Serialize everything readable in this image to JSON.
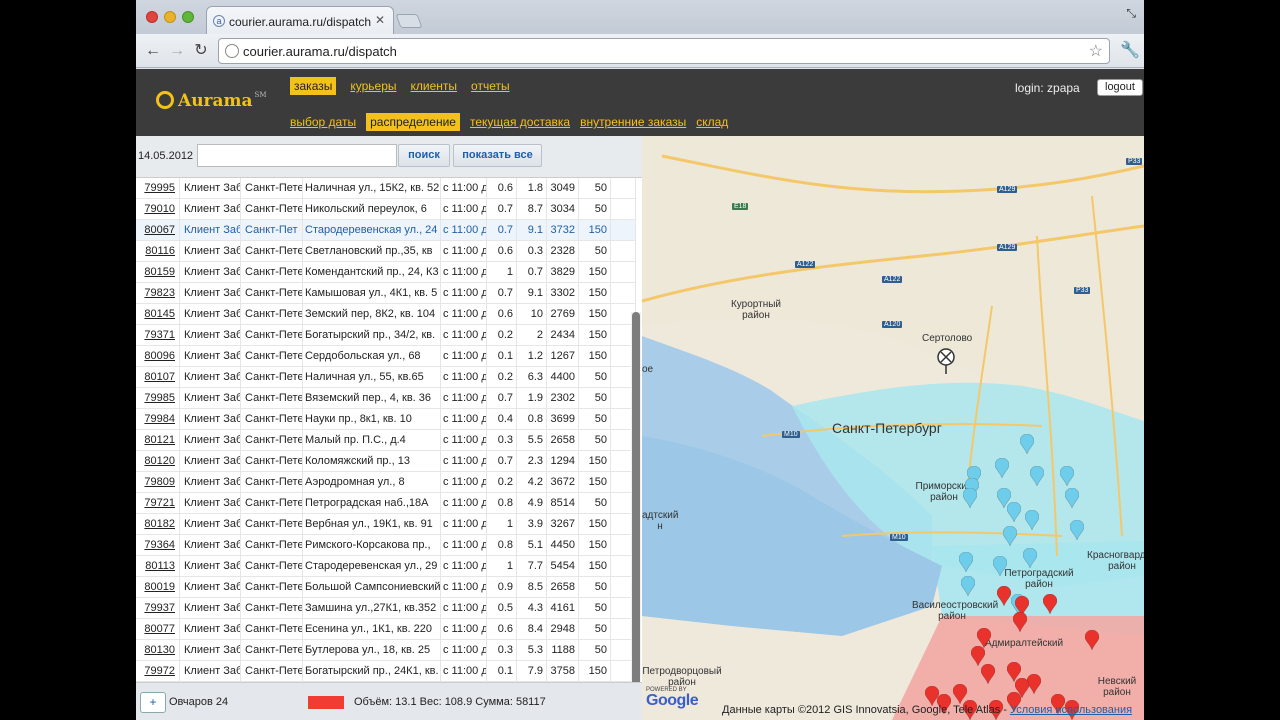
{
  "browser": {
    "tab_title": "courier.aurama.ru/dispatch",
    "url": "courier.aurama.ru/dispatch"
  },
  "app": {
    "logo": "Aurama",
    "logo_mark": "SM",
    "main_nav": [
      "заказы",
      "курьеры",
      "клиенты",
      "отчеты"
    ],
    "sub_nav": [
      "выбор даты",
      "распределение",
      "текущая доставка",
      "внутренние заказы",
      "склад"
    ],
    "main_active": 0,
    "sub_active": 1,
    "login_text": "login: zpapa",
    "logout_label": "logout"
  },
  "filter": {
    "date": "14.05.2012",
    "search_value": "",
    "search_label": "поиск",
    "show_all_label": "показать все"
  },
  "orders": [
    {
      "id": "79995",
      "client": "Клиент Заб",
      "city": "Санкт-Петер",
      "address": "Наличная ул., 15К2, кв. 52",
      "time": "с 11:00 д",
      "a": "0.6",
      "b": "1.8",
      "c": "3049",
      "d": "50"
    },
    {
      "id": "79010",
      "client": "Клиент Заб",
      "city": "Санкт-Петер",
      "address": "Никольский переулок, 6",
      "time": "с 11:00 д",
      "a": "0.7",
      "b": "8.7",
      "c": "3034",
      "d": "50"
    },
    {
      "id": "80067",
      "client": "Клиент Заб",
      "city": "Санкт-Пет",
      "address": "Стародеревенская ул., 24",
      "time": "с 11:00 д",
      "a": "0.7",
      "b": "9.1",
      "c": "3732",
      "d": "150",
      "selected": true
    },
    {
      "id": "80116",
      "client": "Клиент Заб",
      "city": "Санкт-Петер",
      "address": "Светлановский пр.,35, кв",
      "time": "с 11:00 д",
      "a": "0.6",
      "b": "0.3",
      "c": "2328",
      "d": "50"
    },
    {
      "id": "80159",
      "client": "Клиент Заб",
      "city": "Санкт-Петер",
      "address": "Комендантский пр., 24, К3",
      "time": "с 11:00 д",
      "a": "1",
      "b": "0.7",
      "c": "3829",
      "d": "150"
    },
    {
      "id": "79823",
      "client": "Клиент Заб",
      "city": "Санкт-Петер",
      "address": "Камышовая ул., 4К1, кв. 5",
      "time": "с 11:00 д",
      "a": "0.7",
      "b": "9.1",
      "c": "3302",
      "d": "150"
    },
    {
      "id": "80145",
      "client": "Клиент Заб",
      "city": "Санкт-Петер",
      "address": "Земский пер, 8К2, кв. 104",
      "time": "с 11:00 д",
      "a": "0.6",
      "b": "10",
      "c": "2769",
      "d": "150"
    },
    {
      "id": "79371",
      "client": "Клиент Заб",
      "city": "Санкт-Петер",
      "address": "Богатырский пр., 34/2, кв.",
      "time": "с 11:00 д",
      "a": "0.2",
      "b": "2",
      "c": "2434",
      "d": "150"
    },
    {
      "id": "80096",
      "client": "Клиент Заб",
      "city": "Санкт-Петер",
      "address": "Сердобольская ул., 68",
      "time": "с 11:00 д",
      "a": "0.1",
      "b": "1.2",
      "c": "1267",
      "d": "150"
    },
    {
      "id": "80107",
      "client": "Клиент Заб",
      "city": "Санкт-Петер",
      "address": "Наличная ул., 55, кв.65",
      "time": "с 11:00 д",
      "a": "0.2",
      "b": "6.3",
      "c": "4400",
      "d": "50"
    },
    {
      "id": "79985",
      "client": "Клиент Заб",
      "city": "Санкт-Петер",
      "address": "Вяземский пер., 4, кв. 36",
      "time": "с 11:00 д",
      "a": "0.7",
      "b": "1.9",
      "c": "2302",
      "d": "50"
    },
    {
      "id": "79984",
      "client": "Клиент Заб",
      "city": "Санкт-Петер",
      "address": "Науки пр., 8к1, кв. 10",
      "time": "с 11:00 д",
      "a": "0.4",
      "b": "0.8",
      "c": "3699",
      "d": "50"
    },
    {
      "id": "80121",
      "client": "Клиент Заб",
      "city": "Санкт-Петер",
      "address": "Малый пр. П.С., д.4",
      "time": "с 11:00 д",
      "a": "0.3",
      "b": "5.5",
      "c": "2658",
      "d": "50"
    },
    {
      "id": "80120",
      "client": "Клиент Заб",
      "city": "Санкт-Петер",
      "address": "Коломяжский пр., 13",
      "time": "с 11:00 д",
      "a": "0.7",
      "b": "2.3",
      "c": "1294",
      "d": "150"
    },
    {
      "id": "79809",
      "client": "Клиент Заб",
      "city": "Санкт-Петер",
      "address": "Аэродромная ул., 8",
      "time": "с 11:00 д",
      "a": "0.2",
      "b": "4.2",
      "c": "3672",
      "d": "150"
    },
    {
      "id": "79721",
      "client": "Клиент Заб",
      "city": "Санкт-Петер",
      "address": "Петроградская наб.,18А",
      "time": "с 11:00 д",
      "a": "0.8",
      "b": "4.9",
      "c": "8514",
      "d": "50"
    },
    {
      "id": "80182",
      "client": "Клиент Заб",
      "city": "Санкт-Петер",
      "address": "Вербная ул., 19К1, кв. 91",
      "time": "с 11:00 д",
      "a": "1",
      "b": "3.9",
      "c": "3267",
      "d": "150"
    },
    {
      "id": "79364",
      "client": "Клиент Заб",
      "city": "Санкт-Петер",
      "address": "Римского-Корсакова пр.,",
      "time": "с 11:00 д",
      "a": "0.8",
      "b": "5.1",
      "c": "4450",
      "d": "150"
    },
    {
      "id": "80113",
      "client": "Клиент Заб",
      "city": "Санкт-Петер",
      "address": "Стародеревенская ул., 29",
      "time": "с 11:00 д",
      "a": "1",
      "b": "7.7",
      "c": "5454",
      "d": "150"
    },
    {
      "id": "80019",
      "client": "Клиент Заб",
      "city": "Санкт-Петер",
      "address": "Большой Сампсониевский",
      "time": "с 11:00 д",
      "a": "0.9",
      "b": "8.5",
      "c": "2658",
      "d": "50"
    },
    {
      "id": "79937",
      "client": "Клиент Заб",
      "city": "Санкт-Петер",
      "address": "Замшина ул.,27К1, кв.352",
      "time": "с 11:00 д",
      "a": "0.5",
      "b": "4.3",
      "c": "4161",
      "d": "50"
    },
    {
      "id": "80077",
      "client": "Клиент Заб",
      "city": "Санкт-Петер",
      "address": "Есенина ул., 1К1, кв. 220",
      "time": "с 11:00 д",
      "a": "0.6",
      "b": "8.4",
      "c": "2948",
      "d": "50"
    },
    {
      "id": "80130",
      "client": "Клиент Заб",
      "city": "Санкт-Петер",
      "address": "Бутлерова ул., 18, кв. 25",
      "time": "с 11:00 д",
      "a": "0.3",
      "b": "5.3",
      "c": "1188",
      "d": "50"
    },
    {
      "id": "79972",
      "client": "Клиент Заб",
      "city": "Санкт-Петер",
      "address": "Богатырский пр., 24К1, кв.",
      "time": "с 11:00 д",
      "a": "0.1",
      "b": "7.9",
      "c": "3758",
      "d": "150"
    }
  ],
  "footer": {
    "add_label": "+",
    "courier": "Овчаров 24",
    "courier_color": "#f03c32",
    "stats": "Объём: 13.1   Вес: 108.9   Сумма: 58117"
  },
  "map": {
    "labels": {
      "kurort": "Курортный район",
      "sertolovo": "Сертолово",
      "spb": "Санкт-Петербург",
      "primorsky": "Приморский район",
      "petrogradsky": "Петроградский район",
      "vasileostrovsky": "Василеостровский район",
      "admiralteysky": "Адмиралтейский",
      "krasnogvard": "Красногвардейский район",
      "nevsky": "Невский район",
      "petrodvorts": "Петродворцовый район",
      "kolpinsky": "ое",
      "kronshtadt": "адтский н"
    },
    "roads": [
      "P33",
      "E18",
      "A129",
      "A129",
      "A122",
      "A122",
      "P33",
      "A120",
      "M10",
      "M10"
    ],
    "powered_by": "POWERED BY",
    "google": "Google",
    "copyright": "Данные карты ©2012 GIS Innovatsia, Google, Tele Atlas - ",
    "terms_link": "Условия использования",
    "pins": {
      "blue": "#6ecdea",
      "red": "#e8322b",
      "home": "#333333"
    }
  }
}
